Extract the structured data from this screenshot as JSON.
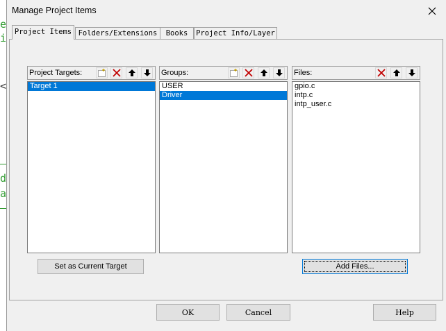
{
  "window": {
    "title": "Manage Project Items"
  },
  "tabs": [
    {
      "label": "Project Items",
      "active": true
    },
    {
      "label": "Folders/Extensions",
      "active": false
    },
    {
      "label": "Books",
      "active": false
    },
    {
      "label": "Project Info/Layer",
      "active": false
    }
  ],
  "targets": {
    "label": "Project Targets:",
    "items": [
      "Target 1"
    ],
    "selected": "Target 1",
    "button": "Set as Current Target"
  },
  "groups": {
    "label": "Groups:",
    "items": [
      "USER",
      "Driver"
    ],
    "selected": "Driver"
  },
  "files": {
    "label": "Files:",
    "items": [
      "gpio.c",
      "intp.c",
      "intp_user.c"
    ],
    "button": "Add Files..."
  },
  "footer": {
    "ok": "OK",
    "cancel": "Cancel",
    "help": "Help"
  },
  "background_editor": {
    "chars": [
      "e",
      "i",
      "<",
      "d",
      "a"
    ]
  },
  "colors": {
    "selection": "#0078d7",
    "delete_icon": "#c00000",
    "editor_text": "#2e9a2e"
  }
}
